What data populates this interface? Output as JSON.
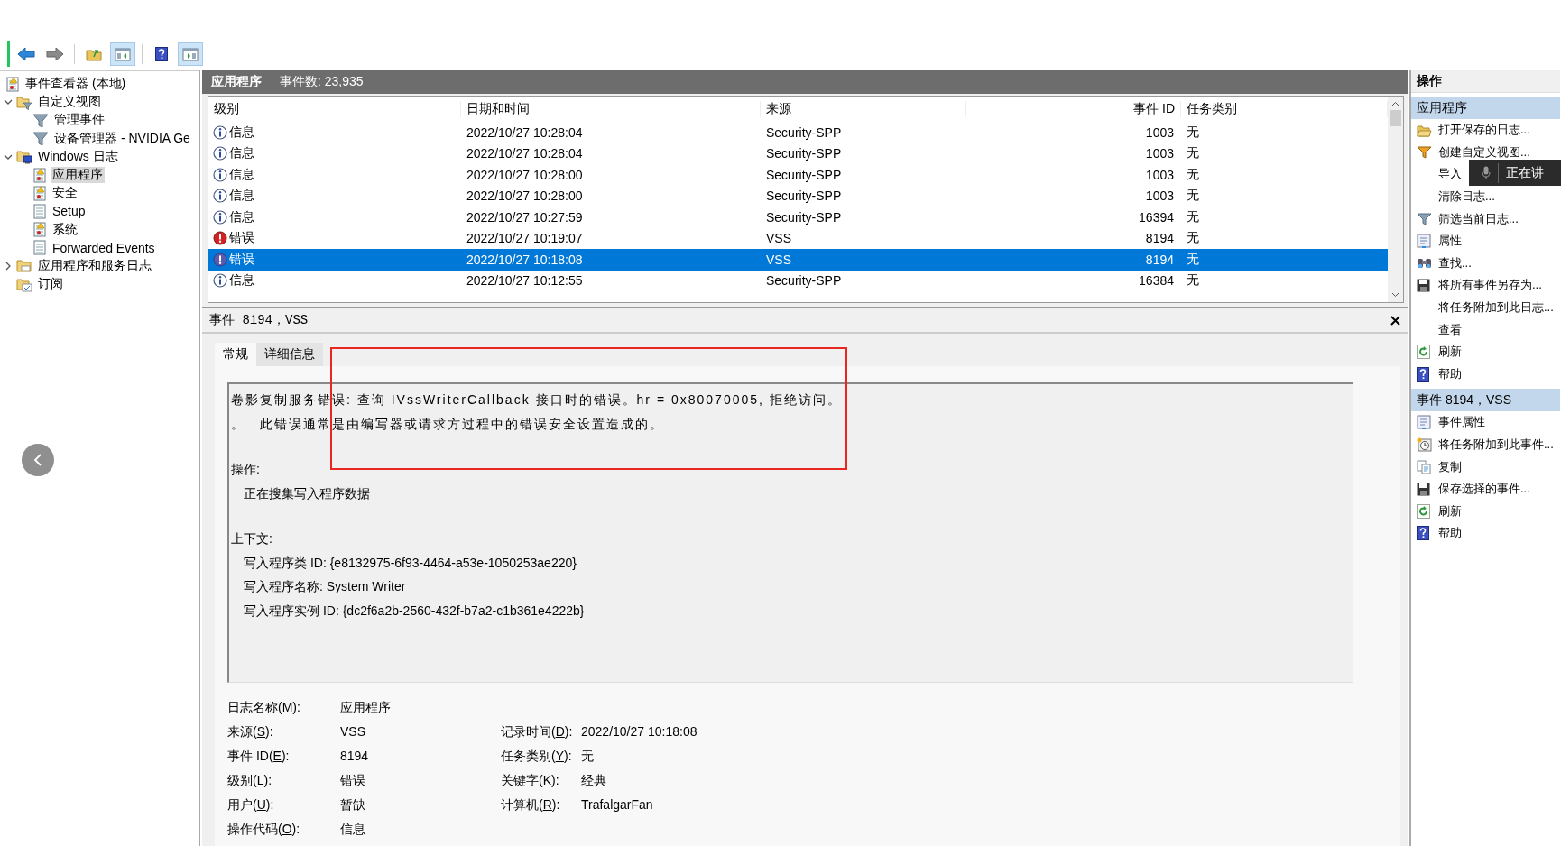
{
  "toolbar": [
    {
      "kind": "back",
      "pressed": false
    },
    {
      "kind": "forward",
      "pressed": false
    },
    {
      "kind": "folder-up",
      "pressed": false
    },
    {
      "kind": "panel-left",
      "pressed": true
    },
    {
      "kind": "help",
      "pressed": false
    },
    {
      "kind": "panel-right",
      "pressed": true
    }
  ],
  "tree": [
    {
      "label": "事件查看器 (本地)",
      "kind": "root",
      "selected": false,
      "children": [
        {
          "label": "自定义视图",
          "kind": "folder-filter",
          "selected": false,
          "expanded": true,
          "children": [
            {
              "label": "管理事件",
              "kind": "filter",
              "selected": false
            },
            {
              "label": "设备管理器 - NVIDIA Ge",
              "kind": "filter",
              "selected": false
            }
          ]
        },
        {
          "label": "Windows 日志",
          "kind": "folder-windows",
          "selected": false,
          "expanded": true,
          "children": [
            {
              "label": "应用程序",
              "kind": "log-warn",
              "selected": true
            },
            {
              "label": "安全",
              "kind": "log-warn",
              "selected": false
            },
            {
              "label": "Setup",
              "kind": "log",
              "selected": false
            },
            {
              "label": "系统",
              "kind": "log-warn",
              "selected": false
            },
            {
              "label": "Forwarded Events",
              "kind": "log",
              "selected": false
            }
          ]
        },
        {
          "label": "应用程序和服务日志",
          "kind": "folder",
          "selected": false,
          "expanded": false
        },
        {
          "label": "订阅",
          "kind": "subscription",
          "selected": false
        }
      ]
    }
  ],
  "log_header": {
    "title": "应用程序",
    "count": "事件数: 23,935"
  },
  "table": {
    "columns": [
      "级别",
      "日期和时间",
      "来源",
      "事件 ID",
      "任务类别"
    ],
    "rows": [
      {
        "kind": "info",
        "level": "信息",
        "datetime": "2022/10/27 10:28:04",
        "source": "Security-SPP",
        "event_id": "1003",
        "task_category": "无",
        "selected": false
      },
      {
        "kind": "info",
        "level": "信息",
        "datetime": "2022/10/27 10:28:04",
        "source": "Security-SPP",
        "event_id": "1003",
        "task_category": "无",
        "selected": false
      },
      {
        "kind": "info",
        "level": "信息",
        "datetime": "2022/10/27 10:28:00",
        "source": "Security-SPP",
        "event_id": "1003",
        "task_category": "无",
        "selected": false
      },
      {
        "kind": "info",
        "level": "信息",
        "datetime": "2022/10/27 10:28:00",
        "source": "Security-SPP",
        "event_id": "1003",
        "task_category": "无",
        "selected": false
      },
      {
        "kind": "info",
        "level": "信息",
        "datetime": "2022/10/27 10:27:59",
        "source": "Security-SPP",
        "event_id": "16394",
        "task_category": "无",
        "selected": false
      },
      {
        "kind": "error",
        "level": "错误",
        "datetime": "2022/10/27 10:19:07",
        "source": "VSS",
        "event_id": "8194",
        "task_category": "无",
        "selected": false
      },
      {
        "kind": "error",
        "level": "错误",
        "datetime": "2022/10/27 10:18:08",
        "source": "VSS",
        "event_id": "8194",
        "task_category": "无",
        "selected": true
      },
      {
        "kind": "info",
        "level": "信息",
        "datetime": "2022/10/27 10:12:55",
        "source": "Security-SPP",
        "event_id": "16384",
        "task_category": "无",
        "selected": false
      }
    ]
  },
  "detail": {
    "title": "事件 8194，VSS",
    "tabs": [
      {
        "label": "常规",
        "selected": true
      },
      {
        "label": "详细信息",
        "selected": false
      }
    ],
    "message": [
      "卷影复制服务错误: 查询 IVssWriterCallback 接口时的错误。hr = 0x80070005, 拒绝访问。",
      "。 此错误通常是由编写器或请求方过程中的错误安全设置造成的。"
    ],
    "sections": [
      {
        "title": "操作:",
        "items": [
          "正在搜集写入程序数据"
        ]
      },
      {
        "title": "上下文:",
        "items": [
          "写入程序类 ID: {e8132975-6f93-4464-a53e-1050253ae220}",
          "写入程序名称: System Writer",
          "写入程序实例 ID: {dc2f6a2b-2560-432f-b7a2-c1b361e4222b}"
        ]
      }
    ],
    "fields": [
      {
        "left": {
          "label_parts": [
            "日志名称(",
            "M",
            "):"
          ],
          "value": "应用程序"
        }
      },
      {
        "left": {
          "label_parts": [
            "来源(",
            "S",
            "):"
          ],
          "value": "VSS"
        },
        "right": {
          "label_parts": [
            "记录时间(",
            "D",
            "):"
          ],
          "value": "2022/10/27 10:18:08"
        }
      },
      {
        "left": {
          "label_parts": [
            "事件 ID(",
            "E",
            "):"
          ],
          "value": "8194"
        },
        "right": {
          "label_parts": [
            "任务类别(",
            "Y",
            "):"
          ],
          "value": "无"
        }
      },
      {
        "left": {
          "label_parts": [
            "级别(",
            "L",
            "):"
          ],
          "value": "错误"
        },
        "right": {
          "label_parts": [
            "关键字(",
            "K",
            "):"
          ],
          "value": "经典"
        }
      },
      {
        "left": {
          "label_parts": [
            "用户(",
            "U",
            "):"
          ],
          "value": "暂缺"
        },
        "right": {
          "label_parts": [
            "计算机(",
            "R",
            "):"
          ],
          "value": "TrafalgarFan"
        }
      },
      {
        "left": {
          "label_parts": [
            "操作代码(",
            "O",
            "):"
          ],
          "value": "信息"
        }
      }
    ]
  },
  "actions": {
    "title": "操作",
    "sections": [
      {
        "title": "应用程序",
        "items": [
          {
            "label": "打开保存的日志...",
            "kind": "open"
          },
          {
            "label": "创建自定义视图...",
            "kind": "filter-new"
          },
          {
            "label": "导入",
            "kind": "none"
          },
          {
            "label": "清除日志...",
            "kind": "none"
          },
          {
            "label": "筛选当前日志...",
            "kind": "filter"
          },
          {
            "label": "属性",
            "kind": "properties"
          },
          {
            "label": "查找...",
            "kind": "find"
          },
          {
            "label": "将所有事件另存为...",
            "kind": "save"
          },
          {
            "label": "将任务附加到此日志...",
            "kind": "none"
          },
          {
            "label": "查看",
            "kind": "none"
          },
          {
            "label": "刷新",
            "kind": "refresh"
          },
          {
            "label": "帮助",
            "kind": "help"
          }
        ]
      },
      {
        "title": "事件 8194，VSS",
        "items": [
          {
            "label": "事件属性",
            "kind": "properties"
          },
          {
            "label": "将任务附加到此事件...",
            "kind": "task"
          },
          {
            "label": "复制",
            "kind": "copy"
          },
          {
            "label": "保存选择的事件...",
            "kind": "save"
          },
          {
            "label": "刷新",
            "kind": "refresh"
          },
          {
            "label": "帮助",
            "kind": "help"
          }
        ]
      }
    ]
  },
  "speech_tooltip": {
    "text": "正在讲"
  }
}
